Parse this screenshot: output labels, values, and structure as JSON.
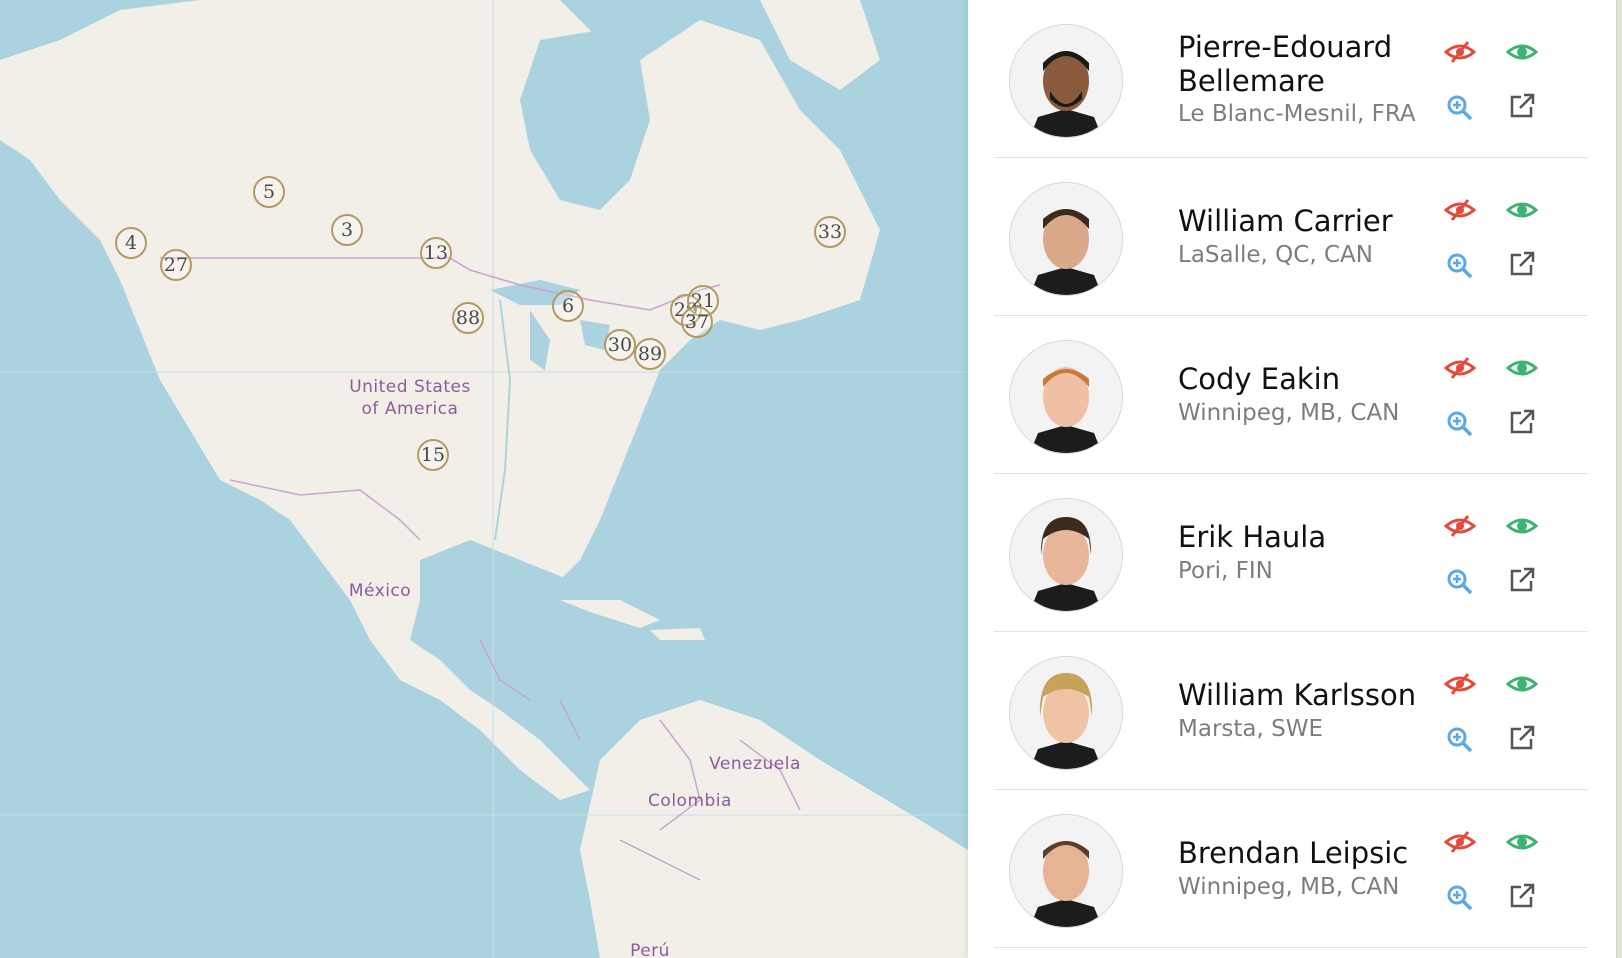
{
  "map": {
    "labels": [
      {
        "id": "usa",
        "text": "United States\nof America"
      },
      {
        "id": "mexico",
        "text": "México"
      },
      {
        "id": "venezuela",
        "text": "Venezuela"
      },
      {
        "id": "colombia",
        "text": "Colombia"
      },
      {
        "id": "peru",
        "text": "Perú"
      }
    ],
    "markers": [
      "5",
      "4",
      "27",
      "3",
      "13",
      "88",
      "6",
      "29",
      "21",
      "37",
      "30",
      "89",
      "33",
      "15"
    ],
    "colors": {
      "water": "#aad3df",
      "land": "#f2efe9",
      "border": "#c9a4cf",
      "marker": "#b39a62"
    }
  },
  "panel": {
    "players": [
      {
        "name": "Pierre-Edouard Bellemare",
        "location": "Le Blanc-Mesnil, FRA"
      },
      {
        "name": "William Carrier",
        "location": "LaSalle, QC, CAN"
      },
      {
        "name": "Cody Eakin",
        "location": "Winnipeg, MB, CAN"
      },
      {
        "name": "Erik Haula",
        "location": "Pori, FIN"
      },
      {
        "name": "William Karlsson",
        "location": "Marsta, SWE"
      },
      {
        "name": "Brendan Leipsic",
        "location": "Winnipeg, MB, CAN"
      }
    ],
    "icons": {
      "hide": "eye-slash-icon",
      "show": "eye-icon",
      "zoom": "zoom-in-icon",
      "open": "external-link-icon"
    },
    "colors": {
      "hide": "#e24a3b",
      "show": "#3cb371",
      "zoom": "#5aa9e6",
      "open": "#555555"
    }
  }
}
